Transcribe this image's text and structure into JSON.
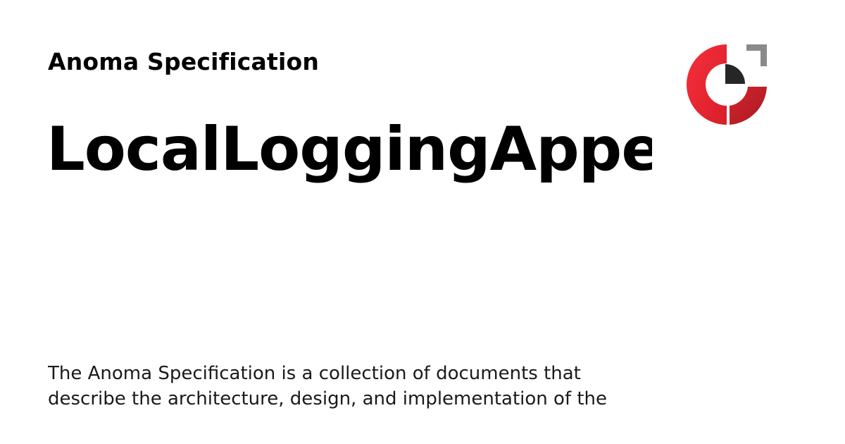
{
  "header": {
    "site_name": "Anoma Specification"
  },
  "main": {
    "title": "LocalLoggingAppe",
    "description": "The Anoma Specification is a collection of documents that describe the architecture, design, and implementation of the"
  },
  "logo": {
    "icon": "anoma-logo-icon",
    "colors": {
      "red": "#f0252f",
      "dark_red": "#c0202a",
      "gray": "#8a8a8a",
      "black": "#262626"
    }
  }
}
